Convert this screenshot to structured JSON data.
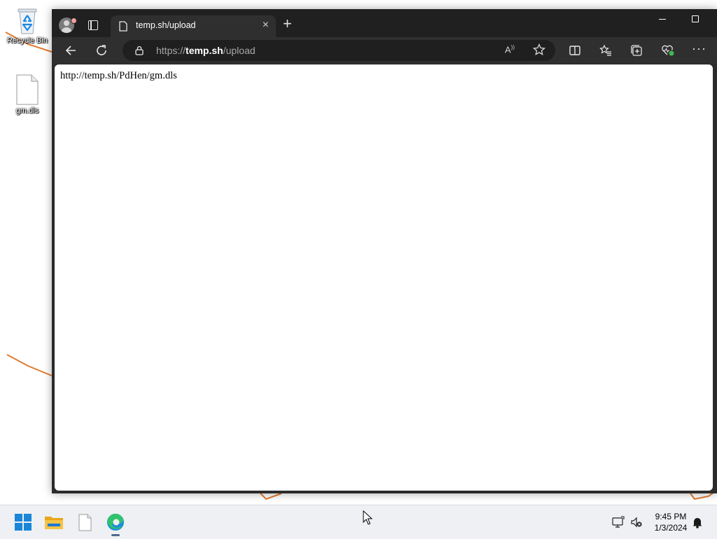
{
  "desktop": {
    "icons": [
      {
        "label": "Recycle Bin",
        "icon": "recycle-bin-icon"
      },
      {
        "label": "gm.dls",
        "icon": "file-icon"
      }
    ]
  },
  "browser": {
    "tab": {
      "title": "temp.sh/upload",
      "icon": "page-icon"
    },
    "address": {
      "scheme": "https://",
      "host": "temp.sh",
      "path": "/upload"
    },
    "toolbar_icons": [
      "back-icon",
      "refresh-icon",
      "read-aloud-icon",
      "favorite-star-icon",
      "split-screen-icon",
      "favorites-icon",
      "collections-icon",
      "browser-essentials-icon",
      "more-icon"
    ],
    "page": {
      "text": "http://temp.sh/PdHen/gm.dls"
    }
  },
  "taskbar": {
    "apps": [
      "start-icon",
      "file-explorer-icon",
      "notepad-icon",
      "edge-icon"
    ],
    "time": "9:45 PM",
    "date": "1/3/2024",
    "tray_icons": [
      "display-icon",
      "speaker-muted-icon",
      "notification-bell-icon"
    ]
  },
  "colors": {
    "accent": "#0078d4",
    "titlebar": "#202020",
    "toolbar": "#2f2f2f",
    "taskbar": "#eef0f3"
  }
}
